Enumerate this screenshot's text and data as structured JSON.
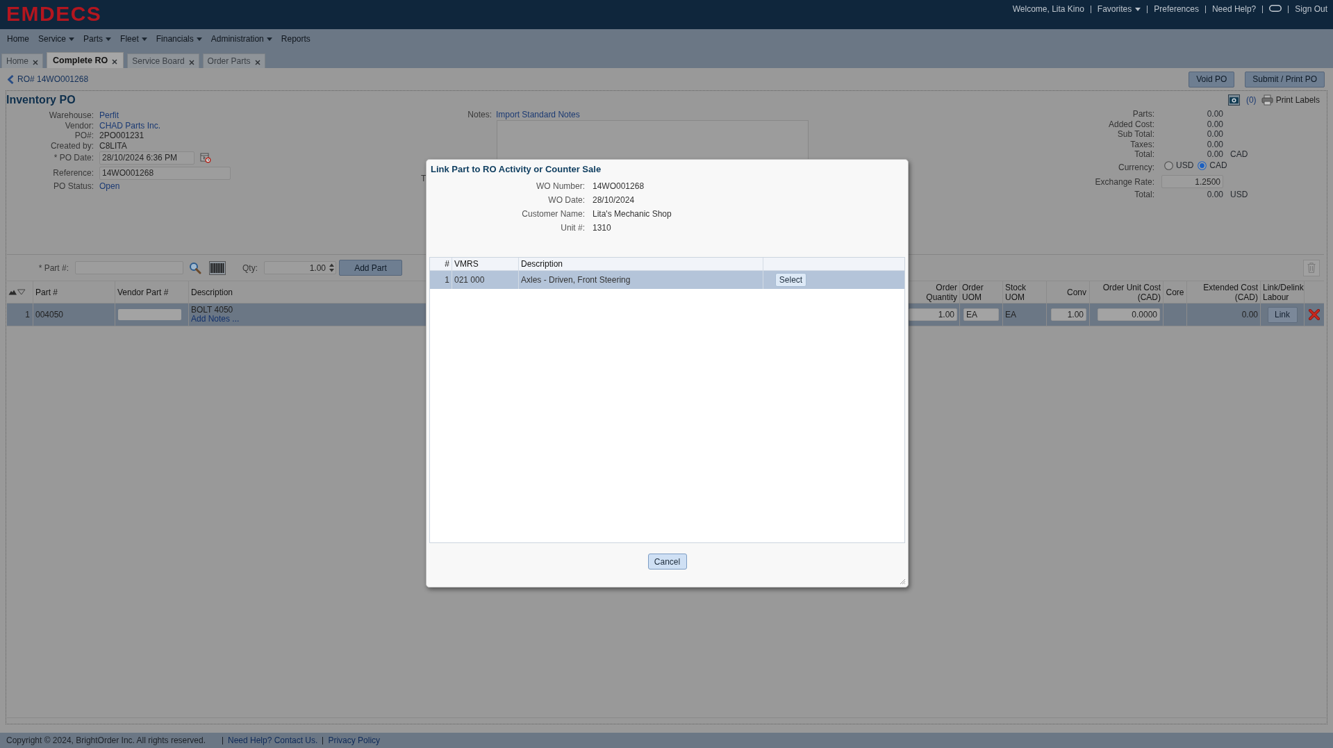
{
  "header": {
    "logo": "EMDECS",
    "links": [
      {
        "kind": "text",
        "label": "Welcome, Lita Kino"
      },
      {
        "kind": "dropdown",
        "label": "Favorites"
      },
      {
        "kind": "link",
        "label": "Preferences"
      },
      {
        "kind": "link",
        "label": "Need Help?"
      },
      {
        "kind": "icon"
      },
      {
        "kind": "link",
        "label": "Sign Out"
      }
    ]
  },
  "menu": [
    {
      "label": "Home",
      "has_menu": false
    },
    {
      "label": "Service",
      "has_menu": true
    },
    {
      "label": "Parts",
      "has_menu": true
    },
    {
      "label": "Fleet",
      "has_menu": true
    },
    {
      "label": "Financials",
      "has_menu": true
    },
    {
      "label": "Administration",
      "has_menu": true
    },
    {
      "label": "Reports",
      "has_menu": false
    }
  ],
  "tabs": [
    {
      "label": "Home",
      "selected": false
    },
    {
      "label": "Complete RO",
      "selected": true
    },
    {
      "label": "Service Board",
      "selected": false
    },
    {
      "label": "Order Parts",
      "selected": false
    }
  ],
  "breadcrumb": {
    "label": "RO# 14WO001268"
  },
  "actions": [
    "Void PO",
    "Submit / Print PO"
  ],
  "form": {
    "title": "Inventory PO",
    "fields": [
      {
        "kind": "link",
        "label": "Warehouse:",
        "value": "Perfit"
      },
      {
        "kind": "link",
        "label": "Vendor:",
        "value": "CHAD Parts Inc."
      },
      {
        "kind": "text",
        "label": "PO#:",
        "value": "2PO001231"
      },
      {
        "kind": "text",
        "label": "Created by:",
        "value": "C8LITA"
      },
      {
        "kind": "date",
        "label": "* PO Date:",
        "value": "28/10/2024 6:36 PM"
      },
      {
        "kind": "input",
        "label": "Reference:",
        "value": "14WO001268"
      },
      {
        "kind": "status",
        "label": "PO Status:",
        "value": "Open"
      }
    ]
  },
  "notes": {
    "label": "Notes:",
    "link": "Import Standard Notes",
    "covered_label": "T"
  },
  "attachments": {
    "count": "(0)",
    "print": "Print Labels"
  },
  "totals": [
    {
      "kind": "amount",
      "label": "Parts:",
      "value": "0.00"
    },
    {
      "kind": "amount",
      "label": "Added Cost:",
      "value": "0.00"
    },
    {
      "kind": "amount",
      "label": "Sub Total:",
      "value": "0.00"
    },
    {
      "kind": "amount",
      "label": "Taxes:",
      "value": "0.00"
    },
    {
      "kind": "amount",
      "label": "Total:",
      "value": "0.00",
      "unit": "CAD"
    },
    {
      "kind": "radio",
      "label": "Currency:",
      "options": [
        {
          "label": "USD",
          "selected": false
        },
        {
          "label": "CAD",
          "selected": true
        }
      ]
    },
    {
      "kind": "input",
      "label": "Exchange Rate:",
      "value": "1.2500"
    },
    {
      "kind": "amount",
      "label": "Total:",
      "value": "0.00",
      "unit": "USD"
    }
  ],
  "part_entry": {
    "part_label": "* Part #:",
    "qty_label": "Qty:",
    "qty_value": "1.00",
    "add_button": "Add Part"
  },
  "grid": {
    "columns": [
      {
        "lines": [
          "Part #"
        ]
      },
      {
        "lines": [
          "Vendor Part #"
        ]
      },
      {
        "lines": [
          "Description"
        ]
      },
      {
        "lines": [
          "Order",
          "Quantity"
        ]
      },
      {
        "lines": [
          "Order",
          "UOM"
        ]
      },
      {
        "lines": [
          "Stock",
          "UOM"
        ]
      },
      {
        "lines": [
          "Conv"
        ]
      },
      {
        "lines": [
          "Order Unit Cost",
          "(CAD)"
        ]
      },
      {
        "lines": [
          "Core"
        ]
      },
      {
        "lines": [
          "Extended Cost",
          "(CAD)"
        ]
      },
      {
        "lines": [
          "Link/Delink",
          "Labour"
        ]
      }
    ],
    "rows": [
      {
        "selected": true,
        "index": "1",
        "part": "004050",
        "description": "BOLT 4050",
        "notes_link": "Add Notes ...",
        "order_quantity": "1.00",
        "order_uom": "EA",
        "stock_uom": "EA",
        "conv": "1.00",
        "unit_cost": "0.0000",
        "extended_cost": "0.00",
        "link": "Link"
      }
    ]
  },
  "dialog": {
    "title": "Link Part to RO Activity or Counter Sale",
    "info": [
      {
        "label": "WO Number:",
        "value": "14WO001268"
      },
      {
        "label": "WO Date:",
        "value": "28/10/2024"
      },
      {
        "label": "Customer Name:",
        "value": "Lita's Mechanic Shop"
      },
      {
        "label": "Unit #:",
        "value": "1310"
      }
    ],
    "columns": [
      "#",
      "VMRS",
      "Description"
    ],
    "rows": [
      {
        "selected": true,
        "index": "1",
        "vmrs": "021 000",
        "description": "Axles - Driven, Front Steering",
        "action": "Select"
      }
    ],
    "cancel": "Cancel"
  },
  "footer": {
    "copyright": "Copyright © 2024, BrightOrder Inc. All rights reserved.",
    "links": [
      "Need Help? Contact Us.",
      "Privacy Policy"
    ]
  }
}
